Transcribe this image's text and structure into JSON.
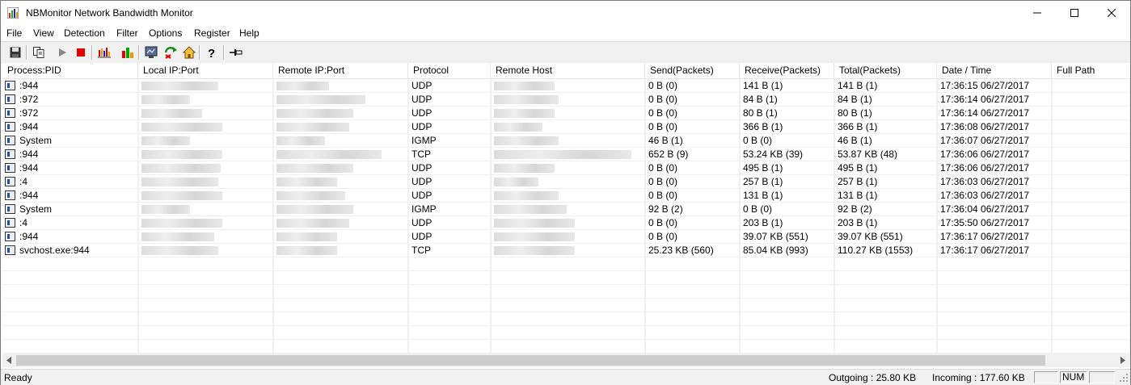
{
  "window": {
    "title": "NBMonitor Network Bandwidth Monitor",
    "controls": [
      "minimize",
      "maximize",
      "close"
    ]
  },
  "menu": [
    "File",
    "View",
    "Detection",
    "Filter",
    "Options",
    "Register",
    "Help"
  ],
  "toolbar": {
    "buttons": [
      {
        "icon": "save-icon"
      },
      {
        "icon": "copy-icon"
      },
      {
        "icon": "play-icon"
      },
      {
        "icon": "stop-icon"
      },
      {
        "icon": "bar-graph-icon"
      },
      {
        "icon": "chart-icon"
      },
      {
        "icon": "monitor-icon"
      },
      {
        "icon": "refresh-icon"
      },
      {
        "icon": "home-icon"
      },
      {
        "icon": "help-icon"
      },
      {
        "icon": "pin-icon"
      }
    ]
  },
  "columns": [
    "Process:PID",
    "Local IP:Port",
    "Remote IP:Port",
    "Protocol",
    "Remote Host",
    "Send(Packets)",
    "Receive(Packets)",
    "Total(Packets)",
    "Date / Time",
    "Full Path"
  ],
  "rows": [
    {
      "process": ":944",
      "protocol": "UDP",
      "send": "0 B (0)",
      "receive": "141 B (1)",
      "total": "141 B (1)",
      "datetime": "17:36:15 06/27/2017"
    },
    {
      "process": ":972",
      "protocol": "UDP",
      "send": "0 B (0)",
      "receive": "84 B (1)",
      "total": "84 B (1)",
      "datetime": "17:36:14 06/27/2017"
    },
    {
      "process": ":972",
      "protocol": "UDP",
      "send": "0 B (0)",
      "receive": "80 B (1)",
      "total": "80 B (1)",
      "datetime": "17:36:14 06/27/2017"
    },
    {
      "process": ":944",
      "protocol": "UDP",
      "send": "0 B (0)",
      "receive": "366 B (1)",
      "total": "366 B (1)",
      "datetime": "17:36:08 06/27/2017"
    },
    {
      "process": "System",
      "protocol": "IGMP",
      "send": "46 B (1)",
      "receive": "0 B (0)",
      "total": "46 B (1)",
      "datetime": "17:36:07 06/27/2017"
    },
    {
      "process": ":944",
      "protocol": "TCP",
      "send": "652 B (9)",
      "receive": "53.24 KB (39)",
      "total": "53.87 KB (48)",
      "datetime": "17:36:06 06/27/2017"
    },
    {
      "process": ":944",
      "protocol": "UDP",
      "send": "0 B (0)",
      "receive": "495 B (1)",
      "total": "495 B (1)",
      "datetime": "17:36:06 06/27/2017"
    },
    {
      "process": ":4",
      "protocol": "UDP",
      "send": "0 B (0)",
      "receive": "257 B (1)",
      "total": "257 B (1)",
      "datetime": "17:36:03 06/27/2017"
    },
    {
      "process": ":944",
      "protocol": "UDP",
      "send": "0 B (0)",
      "receive": "131 B (1)",
      "total": "131 B (1)",
      "datetime": "17:36:03 06/27/2017"
    },
    {
      "process": "System",
      "protocol": "IGMP",
      "send": "92 B (2)",
      "receive": "0 B (0)",
      "total": "92 B (2)",
      "datetime": "17:36:04 06/27/2017"
    },
    {
      "process": ":4",
      "protocol": "UDP",
      "send": "0 B (0)",
      "receive": "203 B (1)",
      "total": "203 B (1)",
      "datetime": "17:35:50 06/27/2017"
    },
    {
      "process": ":944",
      "protocol": "UDP",
      "send": "0 B (0)",
      "receive": "39.07 KB (551)",
      "total": "39.07 KB (551)",
      "datetime": "17:36:17 06/27/2017"
    },
    {
      "process": "svchost.exe:944",
      "protocol": "TCP",
      "send": "25.23 KB (560)",
      "receive": "85.04 KB (993)",
      "total": "110.27 KB (1553)",
      "datetime": "17:36:17 06/27/2017"
    }
  ],
  "status": {
    "left": "Ready",
    "outgoing": "Outgoing : 25.80 KB",
    "incoming": "Incoming : 177.60 KB",
    "num": "NUM"
  }
}
